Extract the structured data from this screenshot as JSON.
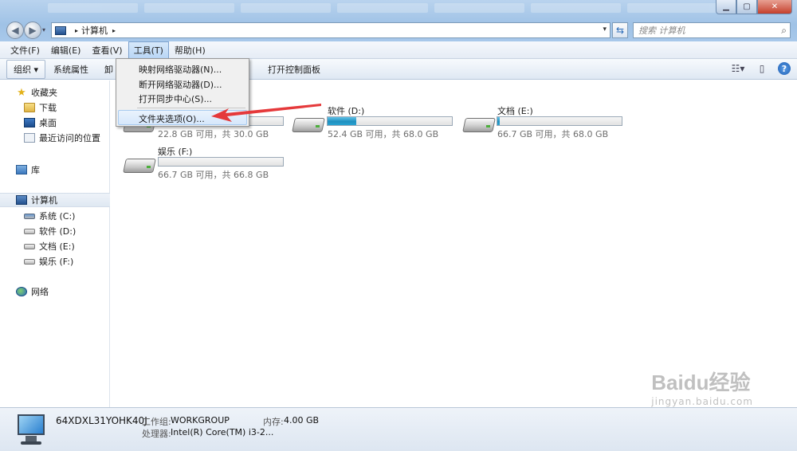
{
  "window": {
    "controls": {
      "minimize": "▁",
      "maximize": "▢",
      "close": "✕"
    }
  },
  "address": {
    "crumb": "计算机",
    "separator": "▸",
    "dropdown": "▾"
  },
  "search": {
    "placeholder": "搜索 计算机",
    "icon": "search-icon"
  },
  "menubar": {
    "items": [
      "文件(F)",
      "编辑(E)",
      "查看(V)",
      "工具(T)",
      "帮助(H)"
    ],
    "active_index": 3
  },
  "cmdbar": {
    "organize": "组织 ▾",
    "system_properties": "系统属性",
    "hidden_short": "卸",
    "control_panel": "打开控制面板"
  },
  "tools_menu": {
    "items": [
      "映射网络驱动器(N)...",
      "断开网络驱动器(D)...",
      "打开同步中心(S)...",
      "文件夹选项(O)..."
    ],
    "highlighted_index": 3
  },
  "sidebar": {
    "favorites": "收藏夹",
    "downloads": "下载",
    "desktop": "桌面",
    "recent": "最近访问的位置",
    "libraries": "库",
    "computer": "计算机",
    "drives": [
      "系统 (C:)",
      "软件 (D:)",
      "文档 (E:)",
      "娱乐 (F:)"
    ],
    "network": "网络"
  },
  "drives": [
    {
      "name": "系统 (C:)",
      "space": "22.8 GB 可用，共 30.0 GB",
      "used_fraction": 0.24
    },
    {
      "name": "软件 (D:)",
      "space": "52.4 GB 可用，共 68.0 GB",
      "used_fraction": 0.23
    },
    {
      "name": "文档 (E:)",
      "space": "66.7 GB 可用，共 68.0 GB",
      "used_fraction": 0.02
    },
    {
      "name": "娱乐 (F:)",
      "space": "66.7 GB 可用，共 66.8 GB",
      "used_fraction": 0.0
    }
  ],
  "details": {
    "computer_name": "64XDXL31YOHK40J",
    "workgroup_label": "工作组:",
    "workgroup": "WORKGROUP",
    "memory_label": "内存:",
    "memory": "4.00 GB",
    "cpu_label": "处理器:",
    "cpu": "Intel(R) Core(TM) i3-2..."
  },
  "watermark": {
    "main": "Baidu经验",
    "sub": "jingyan.baidu.com"
  },
  "colors": {
    "accent": "#2a6fb8",
    "bar_fill": "#1f8fbf",
    "arrow": "#e5393b"
  }
}
